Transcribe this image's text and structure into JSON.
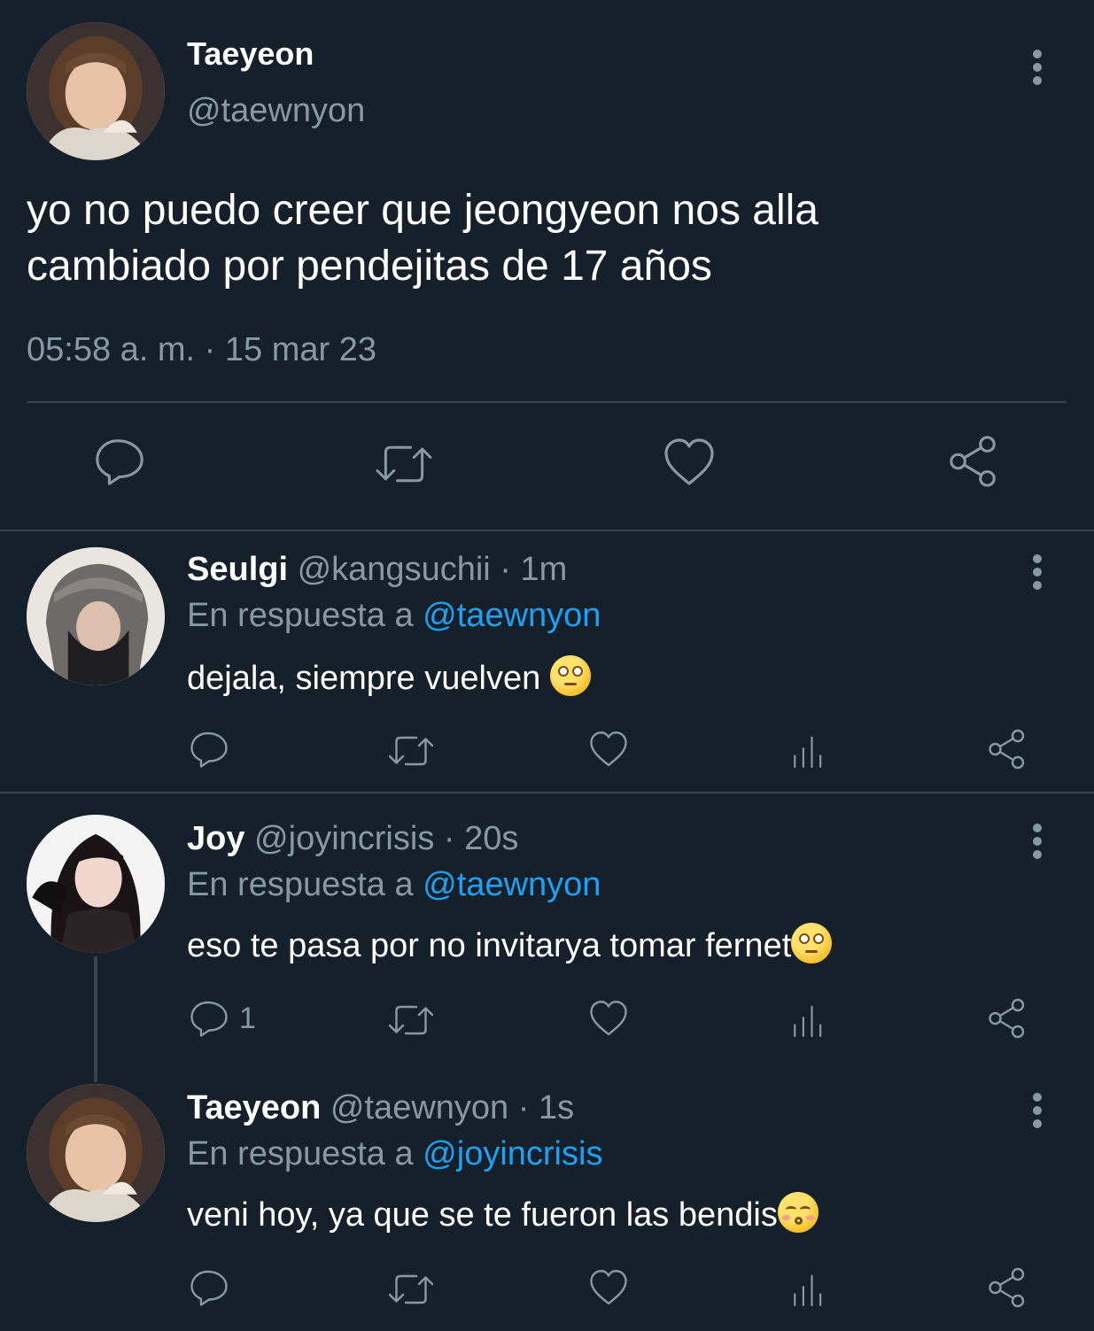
{
  "main_tweet": {
    "author": {
      "name": "Taeyeon",
      "handle": "@taewnyon"
    },
    "text_line1": "yo no puedo creer que jeongyeon nos alla",
    "text_line2": "cambiado por pendejitas de 17 años",
    "timestamp": "05:58 a. m. · 15 mar 23",
    "actions": [
      "reply-icon",
      "retweet-icon",
      "like-icon",
      "share-icon"
    ]
  },
  "replies": [
    {
      "name": "Seulgi",
      "handle": "@kangsuchii",
      "time": "· 1m",
      "replying_prefix": "En respuesta a",
      "replying_to": "@taewnyon",
      "text": "dejala, siempre vuelven ",
      "emoji": "eye-roll-emoji",
      "reply_count": ""
    },
    {
      "name": "Joy",
      "handle": "@joyincrisis",
      "time": "· 20s",
      "replying_prefix": "En respuesta a",
      "replying_to": "@taewnyon",
      "text": "eso te pasa por no invitarya tomar fernet",
      "emoji": "eye-roll-emoji",
      "reply_count": "1"
    },
    {
      "name": "Taeyeon",
      "handle": "@taewnyon",
      "time": "· 1s",
      "replying_prefix": "En respuesta a",
      "replying_to": "@joyincrisis",
      "text": "veni hoy, ya que se te fueron las bendis",
      "emoji": "kissing-emoji",
      "reply_count": ""
    }
  ],
  "colors": {
    "background": "#15202b",
    "secondary_text": "#8899a6",
    "link": "#1da1f2",
    "divider": "#38444d"
  }
}
